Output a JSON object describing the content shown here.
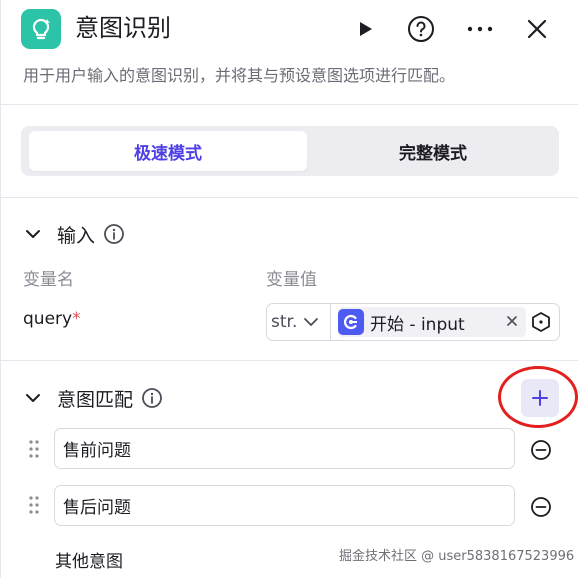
{
  "header": {
    "title": "意图识别",
    "description": "用于用户输入的意图识别，并将其与预设意图选项进行匹配。"
  },
  "mode_tabs": [
    {
      "label": "极速模式",
      "active": true
    },
    {
      "label": "完整模式",
      "active": false
    }
  ],
  "input_section": {
    "title": "输入",
    "col_name": "变量名",
    "col_value": "变量值",
    "variable": {
      "name": "query",
      "required_mark": "*",
      "type": "str.",
      "ref": "开始 - input"
    }
  },
  "intent_section": {
    "title": "意图匹配",
    "intents": [
      {
        "value": "售前问题"
      },
      {
        "value": "售后问题"
      }
    ],
    "other_label": "其他意图"
  },
  "watermark": "掘金技术社区 @ user5838167523996",
  "colors": {
    "accent": "#4e40e5",
    "node_icon": "#2bc4a9",
    "ref_icon": "#4e5bf2",
    "required": "#e34d59",
    "annotation": "#e3201e"
  }
}
